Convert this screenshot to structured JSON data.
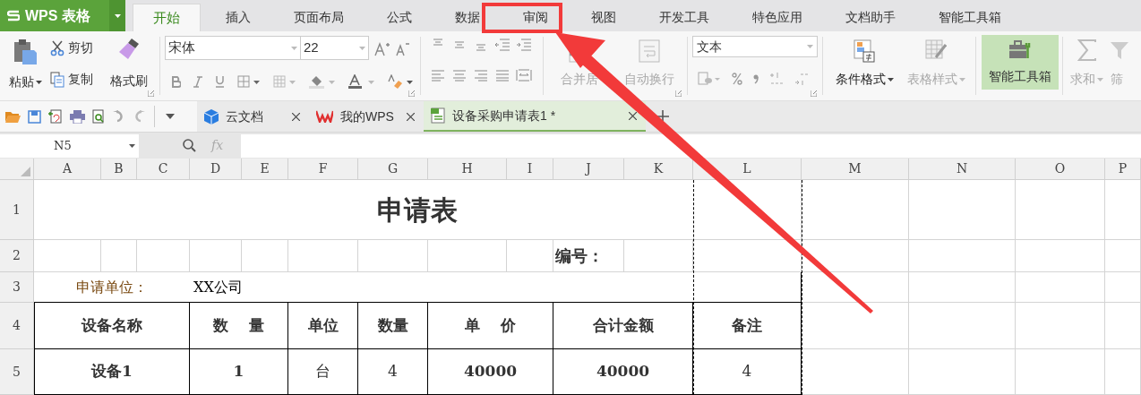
{
  "app_button": {
    "label": "WPS 表格"
  },
  "menu_tabs": [
    {
      "label": "开始",
      "selected": true
    },
    {
      "label": "插入",
      "selected": false
    },
    {
      "label": "页面布局",
      "selected": false
    },
    {
      "label": "公式",
      "selected": false
    },
    {
      "label": "数据",
      "selected": false
    },
    {
      "label": "审阅",
      "selected": false
    },
    {
      "label": "视图",
      "selected": false
    },
    {
      "label": "开发工具",
      "selected": false
    },
    {
      "label": "特色应用",
      "selected": false
    },
    {
      "label": "文档助手",
      "selected": false
    },
    {
      "label": "智能工具箱",
      "selected": false
    }
  ],
  "ribbon": {
    "paste": "粘贴",
    "cut": "剪切",
    "copy": "复制",
    "format_painter": "格式刷",
    "font_name": "宋体",
    "font_size": "22",
    "merge_center": {
      "label": "合并居",
      "disabled": true
    },
    "wrap_text": {
      "label": "自动换行",
      "disabled": true
    },
    "number_format": "文本",
    "conditional_format": {
      "label": "条件格式",
      "disabled": false
    },
    "table_style": {
      "label": "表格样式",
      "disabled": true
    },
    "smart_toolbox": {
      "label": "智能工具箱",
      "selected": true
    },
    "sum": {
      "label": "求和",
      "disabled": true
    },
    "filter": {
      "label": "筛",
      "disabled": true
    }
  },
  "doc_tabs": [
    {
      "label": "云文档",
      "kind": "cloud",
      "selected": false
    },
    {
      "label": "我的WPS",
      "kind": "wps",
      "selected": false
    },
    {
      "label": "设备采购申请表1 *",
      "kind": "sheet",
      "selected": true
    }
  ],
  "formula_bar": {
    "name_box": "N5",
    "fx": "fx"
  },
  "sheet": {
    "columns": [
      "A",
      "B",
      "C",
      "D",
      "E",
      "F",
      "G",
      "H",
      "I",
      "J",
      "K",
      "L",
      "M",
      "N",
      "O",
      "P"
    ],
    "rows": [
      {
        "header": "1",
        "cells": [
          {
            "text": ""
          },
          {
            "text": ""
          },
          {
            "text": ""
          },
          {
            "text": ""
          },
          {
            "text": ""
          },
          {
            "text": ""
          },
          {
            "text": "申请表",
            "bold": true
          },
          {
            "text": ""
          },
          {
            "text": ""
          },
          {
            "text": ""
          },
          {
            "text": ""
          },
          {
            "text": ""
          }
        ]
      },
      {
        "header": "2",
        "cells": [
          {
            "text": ""
          },
          {
            "text": ""
          },
          {
            "text": ""
          },
          {
            "text": ""
          },
          {
            "text": ""
          },
          {
            "text": ""
          },
          {
            "text": ""
          },
          {
            "text": ""
          },
          {
            "text": ""
          },
          {
            "text": "编号：",
            "bold": true
          },
          {
            "text": ""
          },
          {
            "text": ""
          }
        ]
      },
      {
        "header": "3",
        "cells": [
          {
            "text": ""
          },
          {
            "text": "申请单位：",
            "bold": false,
            "color": "#7a4a12"
          },
          {
            "text": ""
          },
          {
            "text": "XX公司",
            "bold": false,
            "color": "#000000"
          },
          {
            "text": ""
          },
          {
            "text": ""
          },
          {
            "text": ""
          },
          {
            "text": ""
          },
          {
            "text": ""
          },
          {
            "text": ""
          },
          {
            "text": ""
          },
          {
            "text": ""
          }
        ]
      },
      {
        "header": "4",
        "cells": [
          {
            "text": ""
          },
          {
            "text": "设备名称",
            "bold": true
          },
          {
            "text": ""
          },
          {
            "text": "数　 量",
            "bold": true
          },
          {
            "text": ""
          },
          {
            "text": "单位",
            "bold": true
          },
          {
            "text": "数量",
            "bold": true
          },
          {
            "text": "单　 价",
            "bold": true
          },
          {
            "text": ""
          },
          {
            "text": "合计金额",
            "bold": true
          },
          {
            "text": ""
          },
          {
            "text": "备注",
            "bold": true
          }
        ]
      },
      {
        "header": "5",
        "cells": [
          {
            "text": ""
          },
          {
            "text": "设备1",
            "bold": true
          },
          {
            "text": ""
          },
          {
            "text": "1",
            "bold": true
          },
          {
            "text": ""
          },
          {
            "text": "台",
            "bold": false
          },
          {
            "text": "4",
            "bold": false
          },
          {
            "text": "40000",
            "bold": true
          },
          {
            "text": ""
          },
          {
            "text": "40000",
            "bold": true
          },
          {
            "text": ""
          },
          {
            "text": "4",
            "bold": false
          }
        ]
      }
    ]
  }
}
